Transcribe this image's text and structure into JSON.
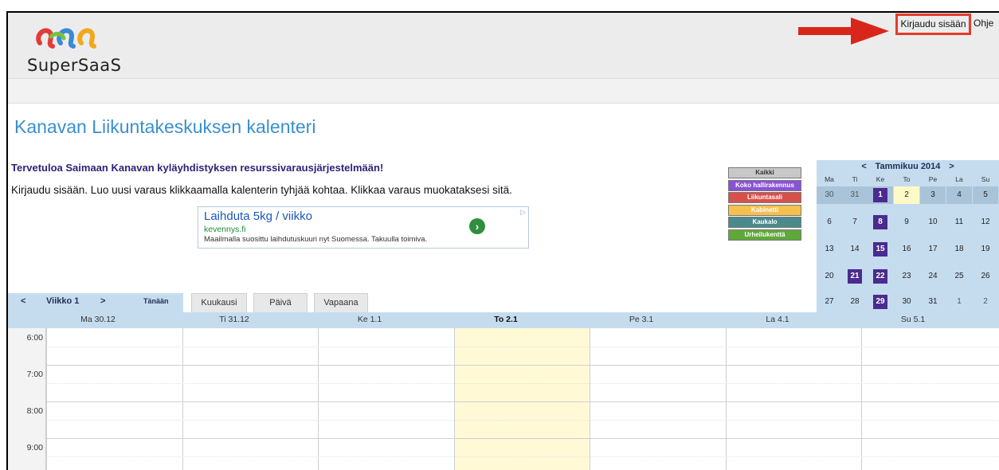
{
  "header": {
    "logo_text": "SuperSaaS",
    "login_label": "Kirjaudu sisään",
    "help_label": "Ohje",
    "arrow_color": "#d9261c"
  },
  "page": {
    "title": "Kanavan Liikuntakeskuksen kalenteri",
    "welcome": "Tervetuloa Saimaan Kanavan kyläyhdistyksen resurssivarausjärjestelmään!",
    "instructions": "Kirjaudu sisään. Luo uusi varaus klikkaamalla kalenterin tyhjää kohtaa. Klikkaa varaus muokataksesi sitä."
  },
  "ad": {
    "title": "Laihduta 5kg / viikko",
    "url": "kevennys.fi",
    "description": "Maailmalla suosittu laihdutuskuuri nyt Suomessa. Takuulla toimiva.",
    "button_icon": "chevron-right-icon",
    "choices_icon": "ad-choices-icon"
  },
  "filters": [
    {
      "label": "Kaikki",
      "color": "#c8c8c8",
      "text_color": "#333333"
    },
    {
      "label": "Koko hallirakennus",
      "color": "#8a52d6",
      "text_color": "#ffffff"
    },
    {
      "label": "Liikuntasali",
      "color": "#d8504a",
      "text_color": "#ffffff"
    },
    {
      "label": "Kabinetti",
      "color": "#f5c04e",
      "text_color": "#ffffff"
    },
    {
      "label": "Kaukalo",
      "color": "#4a8a8c",
      "text_color": "#ffffff"
    },
    {
      "label": "Urheilukenttä",
      "color": "#5fa83a",
      "text_color": "#ffffff"
    }
  ],
  "minical": {
    "prev": "<",
    "next": ">",
    "month_label": "Tammikuu 2014",
    "weekdays": [
      "Ma",
      "Ti",
      "Ke",
      "To",
      "Pe",
      "La",
      "Su"
    ],
    "weeks": [
      [
        "30",
        "31",
        "1",
        "2",
        "3",
        "4",
        "5"
      ],
      [
        "6",
        "7",
        "8",
        "9",
        "10",
        "11",
        "12"
      ],
      [
        "13",
        "14",
        "15",
        "16",
        "17",
        "18",
        "19"
      ],
      [
        "20",
        "21",
        "22",
        "23",
        "24",
        "25",
        "26"
      ],
      [
        "27",
        "28",
        "29",
        "30",
        "31",
        "1",
        "2"
      ]
    ]
  },
  "week_nav": {
    "prev": "<",
    "label": "Viikko 1",
    "next": ">",
    "today": "Tänään"
  },
  "tabs": [
    "Kuukausi",
    "Päivä",
    "Vapaana"
  ],
  "days": [
    "Ma 30.12",
    "Ti 31.12",
    "Ke 1.1",
    "To 2.1",
    "Pe 3.1",
    "La 4.1",
    "Su 5.1"
  ],
  "times": [
    "6:00",
    "7:00",
    "8:00",
    "9:00"
  ]
}
